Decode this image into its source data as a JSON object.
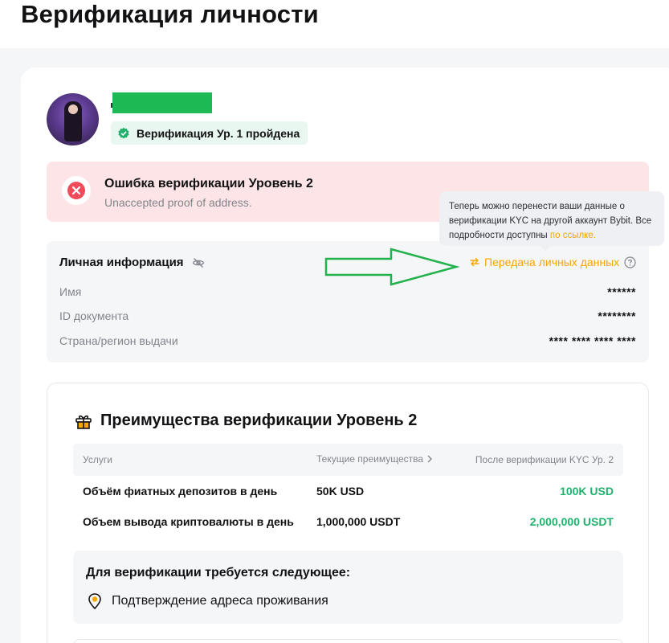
{
  "page": {
    "title": "Верификация личности"
  },
  "profile": {
    "verified_badge": "Верификация Ур. 1 пройдена"
  },
  "error": {
    "title": "Ошибка верификации Уровень 2",
    "subtitle": "Unaccepted proof of address."
  },
  "tooltip": {
    "text": "Теперь можно перенести ваши данные о верификации KYC на другой аккаунт Bybit. Все подробности доступны ",
    "link": "по ссылке."
  },
  "personal_info": {
    "title": "Личная информация",
    "transfer_link": "Передача личных данных",
    "rows": [
      {
        "label": "Имя",
        "value": "******"
      },
      {
        "label": "ID документа",
        "value": "********"
      },
      {
        "label": "Страна/регион выдачи",
        "value": "**** **** **** ****"
      }
    ]
  },
  "benefits": {
    "title": "Преимущества верификации Уровень 2",
    "headers": {
      "service": "Услуги",
      "current": "Текущие преимущества",
      "after": "После верификации KYC Ур. 2"
    },
    "rows": [
      {
        "label": "Объём фиатных депозитов в день",
        "current": "50K USD",
        "after": "100K USD"
      },
      {
        "label": "Объем вывода криптовалюты в день",
        "current": "1,000,000 USDT",
        "after": "2,000,000 USDT"
      }
    ],
    "requirements_title": "Для верификации требуется следующее:",
    "requirement_item": "Подтверждение адреса проживания"
  },
  "colors": {
    "accent": "#f7a600",
    "success": "#20b26c",
    "error_bg": "#fde5e7",
    "redaction": "#1db954",
    "annotation_arrow": "#22b14c"
  },
  "icons": [
    "check-icon",
    "close-icon",
    "eye-slash-icon",
    "swap-icon",
    "help-icon",
    "gift-icon",
    "location-pin-icon",
    "chevron-right-icon"
  ]
}
